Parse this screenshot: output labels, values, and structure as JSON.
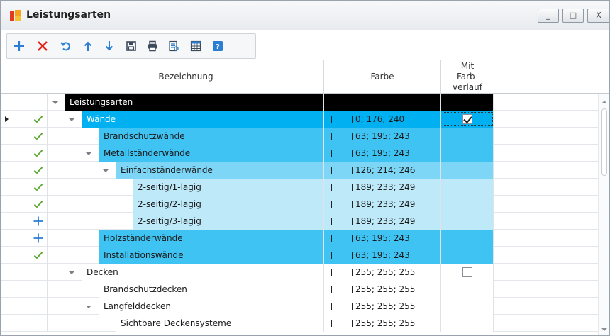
{
  "window": {
    "title": "Leistungsarten",
    "controls": {
      "minimize": "_",
      "maximize": "□",
      "close": "X"
    }
  },
  "toolbar": {
    "buttons": [
      {
        "icon": "add-icon",
        "color": "#2a7fd4"
      },
      {
        "icon": "delete-icon",
        "color": "#e0261b"
      },
      {
        "icon": "refresh-icon",
        "color": "#2a7fd4"
      },
      {
        "icon": "move-up-icon",
        "color": "#2a7fd4"
      },
      {
        "icon": "move-down-icon",
        "color": "#2a7fd4"
      },
      {
        "icon": "save-icon",
        "color": "#3c4b5c"
      },
      {
        "icon": "print-icon",
        "color": "#3c4b5c"
      },
      {
        "icon": "print-preview-icon",
        "color": "#2a7fd4"
      },
      {
        "icon": "columns-icon",
        "color": "#2a7fd4"
      },
      {
        "icon": "help-icon",
        "color": "#2a7fd4"
      }
    ]
  },
  "grid": {
    "headers": {
      "name": "Bezeichnung",
      "color": "Farbe",
      "gradient": "Mit Farb- verlauf"
    },
    "rows": [
      {
        "label": "Leistungsarten",
        "level": 0,
        "expanded": true,
        "bg": "#000000",
        "fg": "#ffffff",
        "color": "",
        "state": "",
        "current": false,
        "gradient": null
      },
      {
        "label": "Wände",
        "level": 1,
        "expanded": true,
        "bg": "#00b0f0",
        "fg": "#ffffff",
        "color": "0; 176; 240",
        "state": "check",
        "current": true,
        "gradient": true
      },
      {
        "label": "Brandschutzwände",
        "level": 2,
        "expanded": null,
        "bg": "#3fc3f3",
        "fg": "#1a1a1a",
        "color": "63; 195; 243",
        "state": "check",
        "current": false,
        "gradient": null
      },
      {
        "label": "Metallständerwände",
        "level": 2,
        "expanded": true,
        "bg": "#3fc3f3",
        "fg": "#1a1a1a",
        "color": "63; 195; 243",
        "state": "check",
        "current": false,
        "gradient": null
      },
      {
        "label": "Einfachständerwände",
        "level": 3,
        "expanded": true,
        "bg": "#7ed6f6",
        "fg": "#1a1a1a",
        "color": "126; 214; 246",
        "state": "check",
        "current": false,
        "gradient": null
      },
      {
        "label": "2-seitig/1-lagig",
        "level": 4,
        "expanded": null,
        "bg": "#bde9f9",
        "fg": "#1a1a1a",
        "color": "189; 233; 249",
        "state": "check",
        "current": false,
        "gradient": null
      },
      {
        "label": "2-seitig/2-lagig",
        "level": 4,
        "expanded": null,
        "bg": "#bde9f9",
        "fg": "#1a1a1a",
        "color": "189; 233; 249",
        "state": "check",
        "current": false,
        "gradient": null
      },
      {
        "label": "2-seitig/3-lagig",
        "level": 4,
        "expanded": null,
        "bg": "#bde9f9",
        "fg": "#1a1a1a",
        "color": "189; 233; 249",
        "state": "plus",
        "current": false,
        "gradient": null
      },
      {
        "label": "Holzständerwände",
        "level": 2,
        "expanded": null,
        "bg": "#3fc3f3",
        "fg": "#1a1a1a",
        "color": "63; 195; 243",
        "state": "plus",
        "current": false,
        "gradient": null
      },
      {
        "label": "Installationswände",
        "level": 2,
        "expanded": null,
        "bg": "#3fc3f3",
        "fg": "#1a1a1a",
        "color": "63; 195; 243",
        "state": "check",
        "current": false,
        "gradient": null
      },
      {
        "label": "Decken",
        "level": 1,
        "expanded": true,
        "bg": "#ffffff",
        "fg": "#1a1a1a",
        "color": "255; 255; 255",
        "state": "",
        "current": false,
        "gradient": false
      },
      {
        "label": "Brandschutzdecken",
        "level": 2,
        "expanded": null,
        "bg": "#ffffff",
        "fg": "#1a1a1a",
        "color": "255; 255; 255",
        "state": "",
        "current": false,
        "gradient": null
      },
      {
        "label": "Langfelddecken",
        "level": 2,
        "expanded": true,
        "bg": "#ffffff",
        "fg": "#1a1a1a",
        "color": "255; 255; 255",
        "state": "",
        "current": false,
        "gradient": null
      },
      {
        "label": "Sichtbare Deckensysteme",
        "level": 3,
        "expanded": null,
        "bg": "#ffffff",
        "fg": "#1a1a1a",
        "color": "255; 255; 255",
        "state": "",
        "current": false,
        "gradient": null
      }
    ]
  },
  "colors": {
    "check": "#5aa832",
    "plus": "#2a7fd4"
  }
}
